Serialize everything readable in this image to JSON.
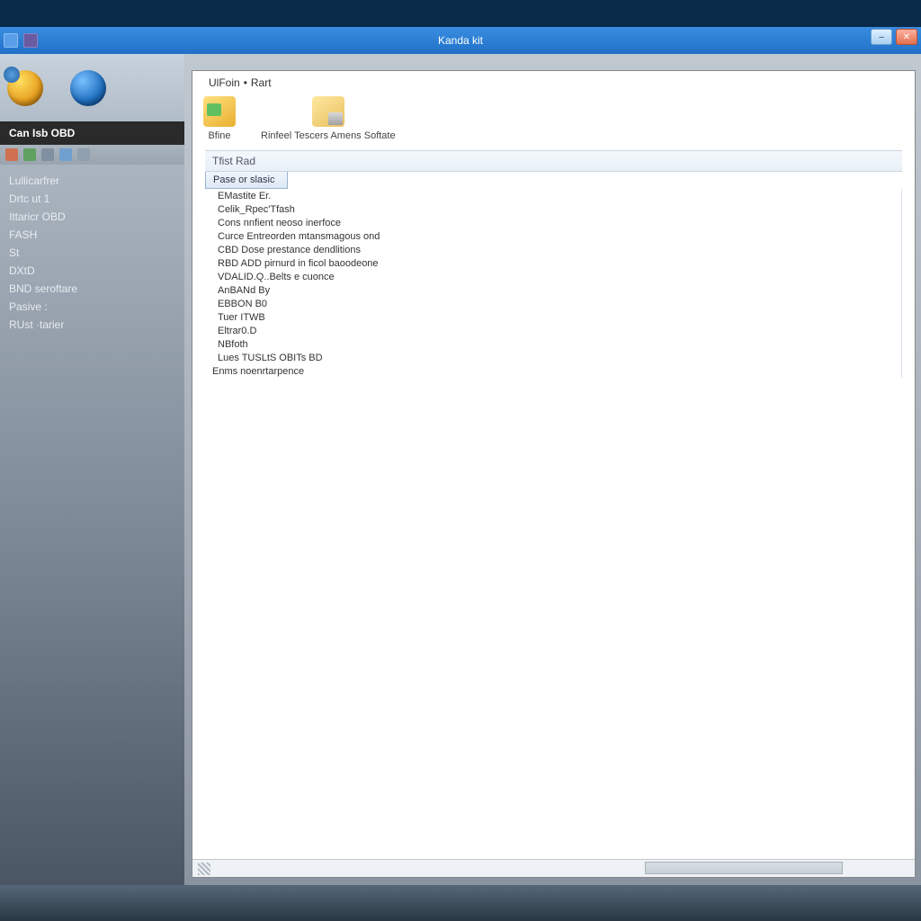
{
  "titlebar": {
    "title": "Kanda kit"
  },
  "sidebar": {
    "header": "Can Isb OBD",
    "items": [
      "Lullicarfrer",
      "Drtc ut 1",
      "Ittaricr OBD",
      "FASH",
      "St",
      "DXtD",
      "BND seroftare",
      "Pasive :",
      "RUst ·tarier"
    ]
  },
  "main": {
    "menu": {
      "item1": "UlFoin",
      "sep": "•",
      "item2": "Rart"
    },
    "toolbar": {
      "btn1": "Bfine",
      "btn2": "Rinfeel Tescers Amens Softate"
    },
    "section_header": "Tfist Rad",
    "column_head": "Pase or slasic",
    "items": [
      "EMastite Er.",
      "Celik_Rpec'Tfash",
      "Cons nnfient neoso inerfoce",
      "Curce Entreorden mtansmagous ond",
      "CBD Dose prestance dendlitions",
      "RBD ADD pirnurd in ficol baoodeone",
      "VDALID.Q..Belts e cuonce",
      "AnBANd By",
      "EBBON B0",
      "Tuer ITWB",
      "Eltrar0.D",
      "NBfoth",
      "Lues TUSLtS OBITs BD"
    ],
    "footer_item": "Enms noenrtarpence"
  }
}
